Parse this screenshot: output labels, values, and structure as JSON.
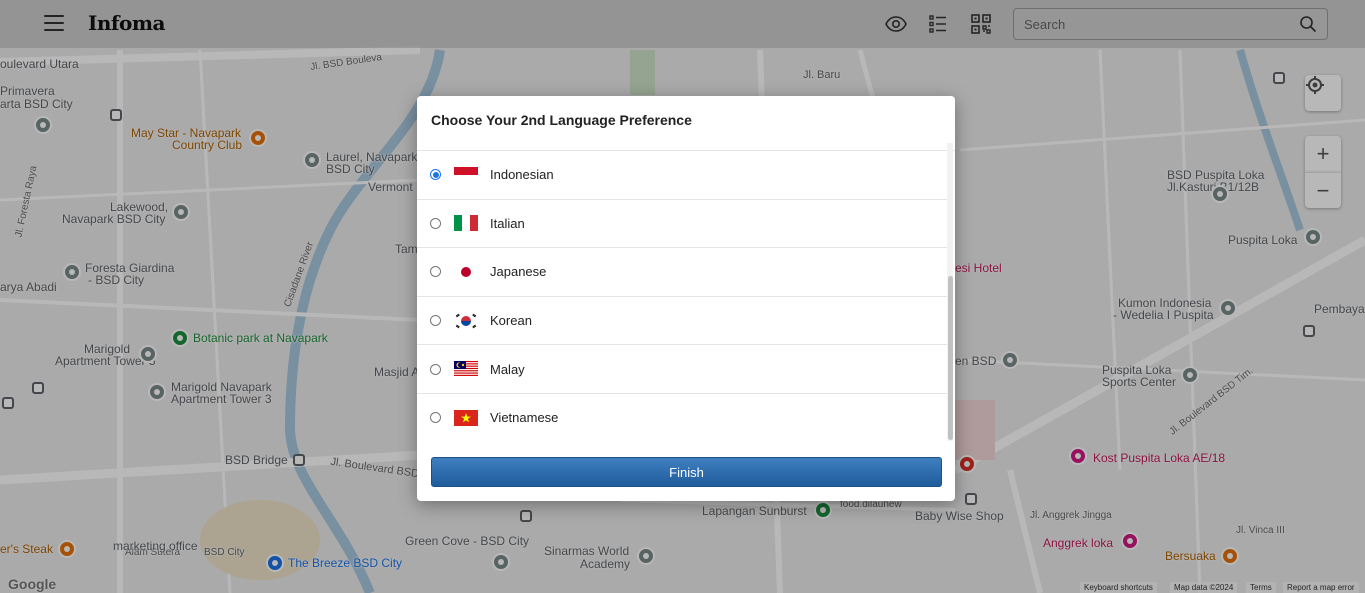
{
  "header": {
    "logo": "Infoma",
    "search_placeholder": "Search"
  },
  "map": {
    "labels": [
      {
        "text": "oulevard Utara",
        "cls": ""
      },
      {
        "text": "Primavera",
        "cls": ""
      },
      {
        "text": "arta BSD City",
        "cls": ""
      },
      {
        "text": "May Star - Navapark",
        "cls": "orange"
      },
      {
        "text": "Country Club",
        "cls": "orange"
      },
      {
        "text": "Laurel, Navapark",
        "cls": ""
      },
      {
        "text": "BSD City",
        "cls": ""
      },
      {
        "text": "Vermont",
        "cls": ""
      },
      {
        "text": "Lakewood,",
        "cls": ""
      },
      {
        "text": "Navapark BSD City",
        "cls": ""
      },
      {
        "text": "Foresta Giardina",
        "cls": ""
      },
      {
        "text": "- BSD City",
        "cls": ""
      },
      {
        "text": "arya Abadi",
        "cls": ""
      },
      {
        "text": "Botanic park at Navapark",
        "cls": "green"
      },
      {
        "text": "Marigold",
        "cls": ""
      },
      {
        "text": "Apartment Tower 5",
        "cls": ""
      },
      {
        "text": "Marigold Navapark",
        "cls": ""
      },
      {
        "text": "Apartment Tower 3",
        "cls": ""
      },
      {
        "text": "Masjid A",
        "cls": ""
      },
      {
        "text": "BSD Bridge",
        "cls": ""
      },
      {
        "text": "Green Cove - BSD City",
        "cls": ""
      },
      {
        "text": "Sinarmas World",
        "cls": ""
      },
      {
        "text": "Academy",
        "cls": ""
      },
      {
        "text": "The Breeze BSD City",
        "cls": "blue"
      },
      {
        "text": "er's Steak",
        "cls": "orange"
      },
      {
        "text": "Alam Sutera",
        "cls": ""
      },
      {
        "text": "BSD City",
        "cls": ""
      },
      {
        "text": "marketing office",
        "cls": ""
      },
      {
        "text": "Lapangan Sunburst",
        "cls": ""
      },
      {
        "text": "Baby Wise Shop",
        "cls": ""
      },
      {
        "text": "Kost Puspita Loka AE/18",
        "cls": "pink"
      },
      {
        "text": "Anggrek loka",
        "cls": "pink"
      },
      {
        "text": "Bersuaka",
        "cls": "orange"
      },
      {
        "text": "BSD Puspita Loka",
        "cls": ""
      },
      {
        "text": "Jl.Kasturi B1/12B",
        "cls": ""
      },
      {
        "text": "Puspita Loka",
        "cls": ""
      },
      {
        "text": "Kumon Indonesia",
        "cls": ""
      },
      {
        "text": "- Wedelia I Puspita",
        "cls": ""
      },
      {
        "text": "Puspita Loka",
        "cls": ""
      },
      {
        "text": "Sports Center",
        "cls": ""
      },
      {
        "text": "Pembaya",
        "cls": ""
      },
      {
        "text": "esi Hotel",
        "cls": "pink"
      },
      {
        "text": "en BSD",
        "cls": ""
      },
      {
        "text": "Tam",
        "cls": ""
      },
      {
        "text": "food.dilaunew",
        "cls": ""
      },
      {
        "text": "Jl. BSD Bouleva",
        "cls": "road"
      },
      {
        "text": "Jl. Baru",
        "cls": "road"
      },
      {
        "text": "Jl. Foresta Raya",
        "cls": "road"
      },
      {
        "text": "Cisadane River",
        "cls": "road"
      },
      {
        "text": "Jl. Boulevard BSD",
        "cls": "road"
      },
      {
        "text": "Jl. Boulevard BSD Tim.",
        "cls": "road"
      },
      {
        "text": "Jl. Anggrek Jingga",
        "cls": "road"
      },
      {
        "text": "Jl. Vinca III",
        "cls": "road"
      }
    ],
    "footer": {
      "google": "Google",
      "shortcuts": "Keyboard shortcuts",
      "mapdata": "Map data ©2024",
      "terms": "Terms",
      "report": "Report a map error"
    }
  },
  "modal": {
    "title": "Choose Your 2nd Language Preference",
    "languages": [
      {
        "name": "Indonesian",
        "flag": "id",
        "selected": true
      },
      {
        "name": "Italian",
        "flag": "it",
        "selected": false
      },
      {
        "name": "Japanese",
        "flag": "jp",
        "selected": false
      },
      {
        "name": "Korean",
        "flag": "kr",
        "selected": false
      },
      {
        "name": "Malay",
        "flag": "my",
        "selected": false
      },
      {
        "name": "Vietnamese",
        "flag": "vn",
        "selected": false
      }
    ],
    "finish_label": "Finish"
  },
  "colors": {
    "accent": "#1f5c9c",
    "radio_selected": "#1a73e8"
  }
}
